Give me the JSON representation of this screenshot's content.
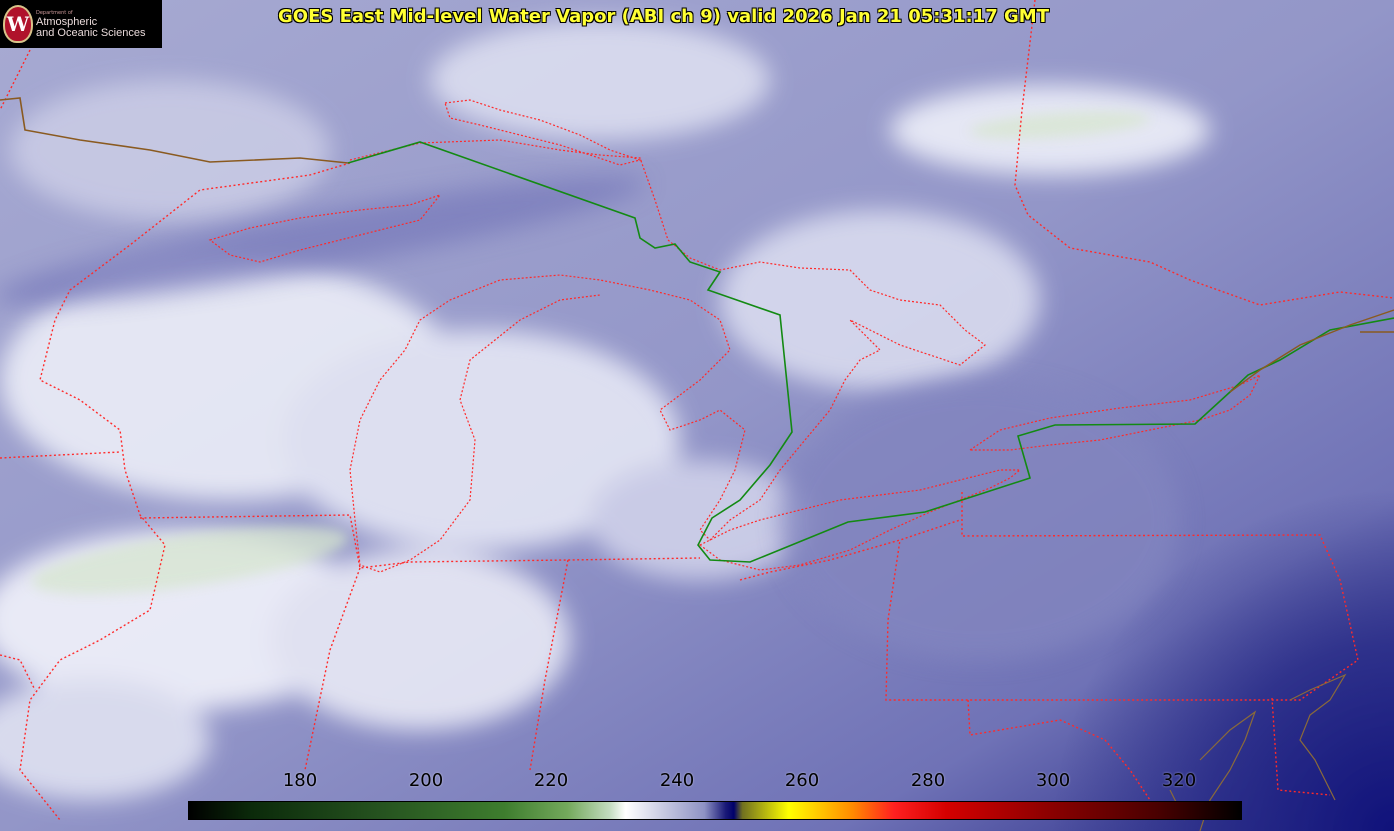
{
  "title": "GOES East Mid-level Water Vapor (ABI ch 9)  valid 2026 Jan 21 05:31:17 GMT",
  "logo": {
    "department": "Department of",
    "line1": "Atmospheric",
    "line2": "and Oceanic Sciences",
    "seal_letter": "W"
  },
  "colorbar": {
    "unit_values": [
      180,
      200,
      220,
      240,
      260,
      280,
      300,
      320
    ],
    "labels": [
      "180",
      "200",
      "220",
      "240",
      "260",
      "280",
      "300",
      "320"
    ]
  },
  "colors": {
    "background_moist": "#8f92c6",
    "dry_deep_blue": "#1c1f80",
    "cloud_white": "#f2f3fb",
    "cold_green": "#c9dcc2",
    "state_border": "#ff2a2a",
    "country_border": "#138a13",
    "title_text": "#ffff33"
  }
}
